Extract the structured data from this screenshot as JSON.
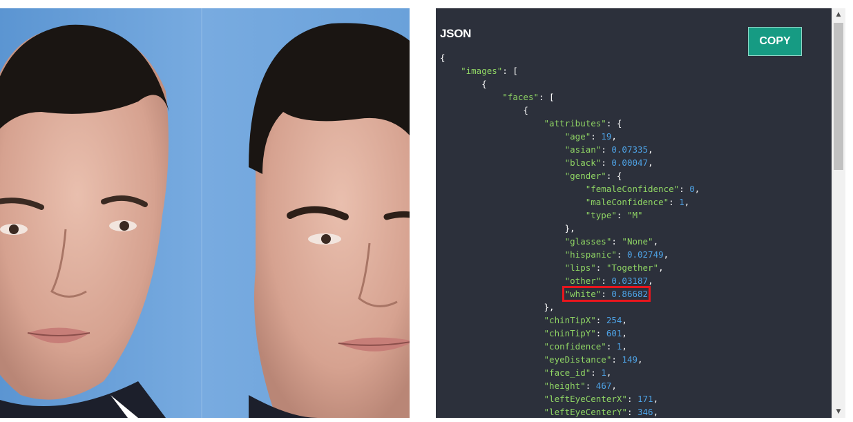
{
  "json_panel": {
    "title": "JSON",
    "copy_label": "COPY",
    "lines": [
      {
        "indent": 0,
        "tokens": [
          {
            "t": "p",
            "v": "{"
          }
        ]
      },
      {
        "indent": 1,
        "tokens": [
          {
            "t": "k",
            "v": "\"images\""
          },
          {
            "t": "p",
            "v": ": ["
          }
        ]
      },
      {
        "indent": 2,
        "tokens": [
          {
            "t": "p",
            "v": "{"
          }
        ]
      },
      {
        "indent": 3,
        "tokens": [
          {
            "t": "k",
            "v": "\"faces\""
          },
          {
            "t": "p",
            "v": ": ["
          }
        ]
      },
      {
        "indent": 4,
        "tokens": [
          {
            "t": "p",
            "v": "{"
          }
        ]
      },
      {
        "indent": 5,
        "tokens": [
          {
            "t": "k",
            "v": "\"attributes\""
          },
          {
            "t": "p",
            "v": ": {"
          }
        ]
      },
      {
        "indent": 6,
        "tokens": [
          {
            "t": "k",
            "v": "\"age\""
          },
          {
            "t": "p",
            "v": ": "
          },
          {
            "t": "n",
            "v": "19"
          },
          {
            "t": "p",
            "v": ","
          }
        ]
      },
      {
        "indent": 6,
        "tokens": [
          {
            "t": "k",
            "v": "\"asian\""
          },
          {
            "t": "p",
            "v": ": "
          },
          {
            "t": "n",
            "v": "0.07335"
          },
          {
            "t": "p",
            "v": ","
          }
        ]
      },
      {
        "indent": 6,
        "tokens": [
          {
            "t": "k",
            "v": "\"black\""
          },
          {
            "t": "p",
            "v": ": "
          },
          {
            "t": "n",
            "v": "0.00047"
          },
          {
            "t": "p",
            "v": ","
          }
        ]
      },
      {
        "indent": 6,
        "tokens": [
          {
            "t": "k",
            "v": "\"gender\""
          },
          {
            "t": "p",
            "v": ": {"
          }
        ]
      },
      {
        "indent": 7,
        "tokens": [
          {
            "t": "k",
            "v": "\"femaleConfidence\""
          },
          {
            "t": "p",
            "v": ": "
          },
          {
            "t": "n",
            "v": "0"
          },
          {
            "t": "p",
            "v": ","
          }
        ]
      },
      {
        "indent": 7,
        "tokens": [
          {
            "t": "k",
            "v": "\"maleConfidence\""
          },
          {
            "t": "p",
            "v": ": "
          },
          {
            "t": "n",
            "v": "1"
          },
          {
            "t": "p",
            "v": ","
          }
        ]
      },
      {
        "indent": 7,
        "tokens": [
          {
            "t": "k",
            "v": "\"type\""
          },
          {
            "t": "p",
            "v": ": "
          },
          {
            "t": "s",
            "v": "\"M\""
          }
        ]
      },
      {
        "indent": 6,
        "tokens": [
          {
            "t": "p",
            "v": "},"
          }
        ]
      },
      {
        "indent": 6,
        "tokens": [
          {
            "t": "k",
            "v": "\"glasses\""
          },
          {
            "t": "p",
            "v": ": "
          },
          {
            "t": "s",
            "v": "\"None\""
          },
          {
            "t": "p",
            "v": ","
          }
        ]
      },
      {
        "indent": 6,
        "tokens": [
          {
            "t": "k",
            "v": "\"hispanic\""
          },
          {
            "t": "p",
            "v": ": "
          },
          {
            "t": "n",
            "v": "0.02749"
          },
          {
            "t": "p",
            "v": ","
          }
        ]
      },
      {
        "indent": 6,
        "tokens": [
          {
            "t": "k",
            "v": "\"lips\""
          },
          {
            "t": "p",
            "v": ": "
          },
          {
            "t": "s",
            "v": "\"Together\""
          },
          {
            "t": "p",
            "v": ","
          }
        ]
      },
      {
        "indent": 6,
        "tokens": [
          {
            "t": "k",
            "v": "\"other\""
          },
          {
            "t": "p",
            "v": ": "
          },
          {
            "t": "n",
            "v": "0.03187"
          },
          {
            "t": "p",
            "v": ","
          }
        ]
      },
      {
        "indent": 6,
        "highlight": true,
        "tokens": [
          {
            "t": "k",
            "v": "\"white\""
          },
          {
            "t": "p",
            "v": ": "
          },
          {
            "t": "n",
            "v": "0.86682"
          }
        ]
      },
      {
        "indent": 5,
        "tokens": [
          {
            "t": "p",
            "v": "},"
          }
        ]
      },
      {
        "indent": 5,
        "tokens": [
          {
            "t": "k",
            "v": "\"chinTipX\""
          },
          {
            "t": "p",
            "v": ": "
          },
          {
            "t": "n",
            "v": "254"
          },
          {
            "t": "p",
            "v": ","
          }
        ]
      },
      {
        "indent": 5,
        "tokens": [
          {
            "t": "k",
            "v": "\"chinTipY\""
          },
          {
            "t": "p",
            "v": ": "
          },
          {
            "t": "n",
            "v": "601"
          },
          {
            "t": "p",
            "v": ","
          }
        ]
      },
      {
        "indent": 5,
        "tokens": [
          {
            "t": "k",
            "v": "\"confidence\""
          },
          {
            "t": "p",
            "v": ": "
          },
          {
            "t": "n",
            "v": "1"
          },
          {
            "t": "p",
            "v": ","
          }
        ]
      },
      {
        "indent": 5,
        "tokens": [
          {
            "t": "k",
            "v": "\"eyeDistance\""
          },
          {
            "t": "p",
            "v": ": "
          },
          {
            "t": "n",
            "v": "149"
          },
          {
            "t": "p",
            "v": ","
          }
        ]
      },
      {
        "indent": 5,
        "tokens": [
          {
            "t": "k",
            "v": "\"face_id\""
          },
          {
            "t": "p",
            "v": ": "
          },
          {
            "t": "n",
            "v": "1"
          },
          {
            "t": "p",
            "v": ","
          }
        ]
      },
      {
        "indent": 5,
        "tokens": [
          {
            "t": "k",
            "v": "\"height\""
          },
          {
            "t": "p",
            "v": ": "
          },
          {
            "t": "n",
            "v": "467"
          },
          {
            "t": "p",
            "v": ","
          }
        ]
      },
      {
        "indent": 5,
        "tokens": [
          {
            "t": "k",
            "v": "\"leftEyeCenterX\""
          },
          {
            "t": "p",
            "v": ": "
          },
          {
            "t": "n",
            "v": "171"
          },
          {
            "t": "p",
            "v": ","
          }
        ]
      },
      {
        "indent": 5,
        "tokens": [
          {
            "t": "k",
            "v": "\"leftEyeCenterY\""
          },
          {
            "t": "p",
            "v": ": "
          },
          {
            "t": "n",
            "v": "346"
          },
          {
            "t": "p",
            "v": ","
          }
        ]
      }
    ]
  },
  "photo": {
    "background_color": "#6ea2d8",
    "icon": "portrait-photo"
  },
  "scrollbar": {
    "up_icon": "▲",
    "down_icon": "▼"
  },
  "colors": {
    "panel_bg": "#2c303b",
    "key_green": "#8fd464",
    "number_blue": "#4ea3e6",
    "copy_button": "#169b83",
    "highlight_red": "#e8161d"
  }
}
